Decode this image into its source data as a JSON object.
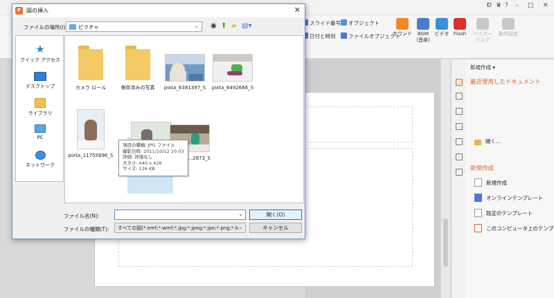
{
  "app": {
    "ribbon_small": [
      "スライド番号",
      "オブジェクト",
      "日付と時刻",
      "ファイルオブジェクト"
    ],
    "ribbon_big": [
      {
        "label": "サウンド",
        "color": "#f08a24"
      },
      {
        "label": "BGM\n(音楽)",
        "color": "#4a7bd0"
      },
      {
        "label": "ビデオ",
        "color": "#3b8ed8"
      },
      {
        "label": "Flash",
        "color": "#d8322a"
      },
      {
        "label": "ハイパー\nリンク",
        "color": "#bdbdbd"
      },
      {
        "label": "動作設定",
        "color": "#bdbdbd"
      }
    ],
    "titlebar_controls": [
      "?",
      "-",
      "□",
      "✕"
    ],
    "task_pane": {
      "header": "新規作成 ▾",
      "recent_title": "最近使用したドキュメント",
      "open_label": "開く...",
      "new_title": "新規作成",
      "items": [
        "新規作成",
        "オンラインテンプレート",
        "既定のテンプレート",
        "このコンピュータ上のテンプレート"
      ]
    }
  },
  "dialog": {
    "title": "図の挿入",
    "location_label": "ファイルの場所(I):",
    "location_value": "ピクチャ",
    "places": [
      "クイック アクセス",
      "デスクトップ",
      "ライブラリ",
      "PC",
      "ネットワーク"
    ],
    "files": [
      {
        "name": "カメラ ロール",
        "kind": "folder"
      },
      {
        "name": "保存済みの写真",
        "kind": "folder"
      },
      {
        "name": "pixta_6381397_S",
        "kind": "photo"
      },
      {
        "name": "pixta_6492666_S",
        "kind": "photo"
      },
      {
        "name": "pixta_11755696_S",
        "kind": "photo"
      },
      {
        "name": "",
        "kind": "photo"
      },
      {
        "name": "...2873_S",
        "kind": "photo"
      }
    ],
    "tooltip": [
      "項目の種類: JPG ファイル",
      "撮影日時: 2011/10/12 10:03",
      "評価: 評価なし",
      "大きさ: 640 x 426",
      "サイズ: 126 KB"
    ],
    "filename_label": "ファイル名(N):",
    "filename_value": "",
    "filetype_label": "ファイルの種類(T):",
    "filetype_value": "すべての図(*.emf;*.wmf;*.jpg;*.jpeg;*.jpe;*.png;*.bm",
    "open_button": "開く(O)",
    "cancel_button": "キャンセル"
  }
}
